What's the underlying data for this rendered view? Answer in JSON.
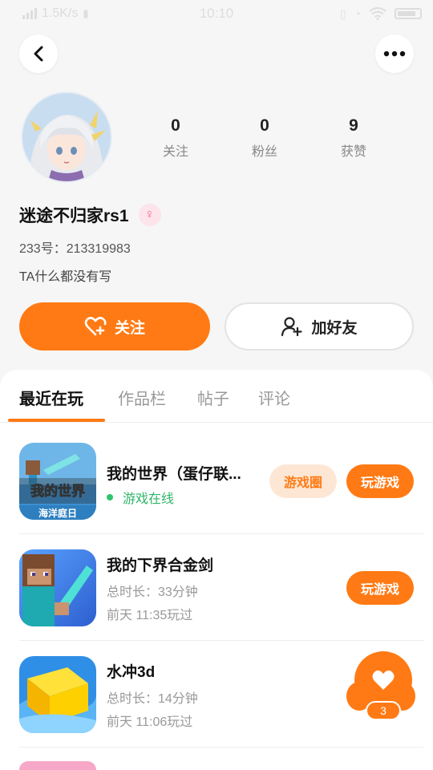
{
  "status": {
    "speed": "1.5K/s",
    "time": "10:10"
  },
  "profile": {
    "stats": [
      {
        "value": "0",
        "label": "关注"
      },
      {
        "value": "0",
        "label": "粉丝"
      },
      {
        "value": "9",
        "label": "获赞"
      }
    ],
    "username": "迷途不归家rs1",
    "gender_symbol": "♀",
    "uid": "233号：213319983",
    "bio": "TA什么都没有写"
  },
  "actions": {
    "follow_label": "关注",
    "add_friend_label": "加好友"
  },
  "tabs": [
    {
      "label": "最近在玩",
      "active": true
    },
    {
      "label": "作品栏",
      "active": false
    },
    {
      "label": "帖子",
      "active": false
    },
    {
      "label": "评论",
      "active": false
    }
  ],
  "games": [
    {
      "title": "我的世界（蛋仔联...",
      "status": "游戏在线",
      "circle_label": "游戏圈",
      "play_label": "玩游戏",
      "icon_text": "我的世界",
      "icon_sub": "海洋庭日"
    },
    {
      "title": "我的下界合金剑",
      "duration": "总时长：33分钟",
      "last_played": "前天 11:35玩过",
      "play_label": "玩游戏"
    },
    {
      "title": "水冲3d",
      "duration": "总时长：14分钟",
      "last_played": "前天 11:06玩过"
    }
  ],
  "like_fab": {
    "count": "3"
  },
  "colors": {
    "accent": "#ff7a14",
    "online": "#2fb56a"
  }
}
